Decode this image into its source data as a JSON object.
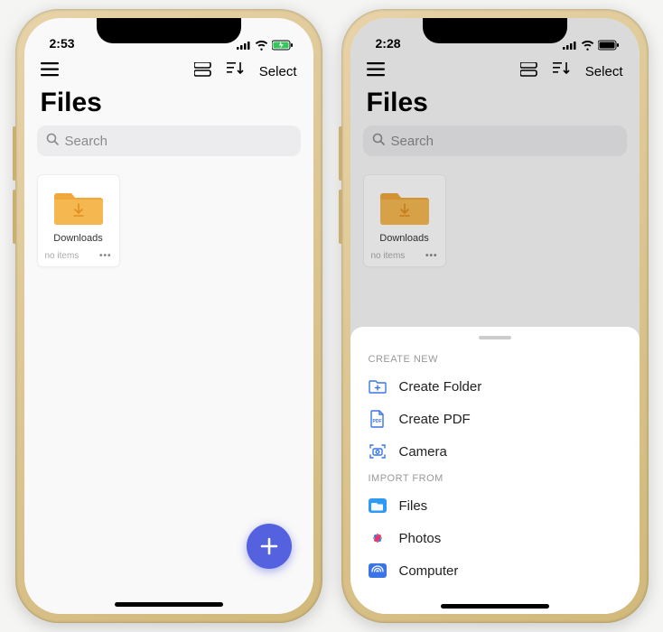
{
  "left": {
    "status": {
      "time": "2:53",
      "battery_charging": true
    },
    "toolbar": {
      "select_label": "Select"
    },
    "title": "Files",
    "search": {
      "placeholder": "Search"
    },
    "folder": {
      "name": "Downloads",
      "subtitle": "no items"
    }
  },
  "right": {
    "status": {
      "time": "2:28",
      "battery_charging": false
    },
    "toolbar": {
      "select_label": "Select"
    },
    "title": "Files",
    "search": {
      "placeholder": "Search"
    },
    "folder": {
      "name": "Downloads",
      "subtitle": "no items"
    },
    "sheet": {
      "create_header": "CREATE NEW",
      "import_header": "IMPORT FROM",
      "create": [
        {
          "label": "Create Folder"
        },
        {
          "label": "Create PDF"
        },
        {
          "label": "Camera"
        }
      ],
      "import": [
        {
          "label": "Files"
        },
        {
          "label": "Photos"
        },
        {
          "label": "Computer"
        }
      ]
    }
  }
}
